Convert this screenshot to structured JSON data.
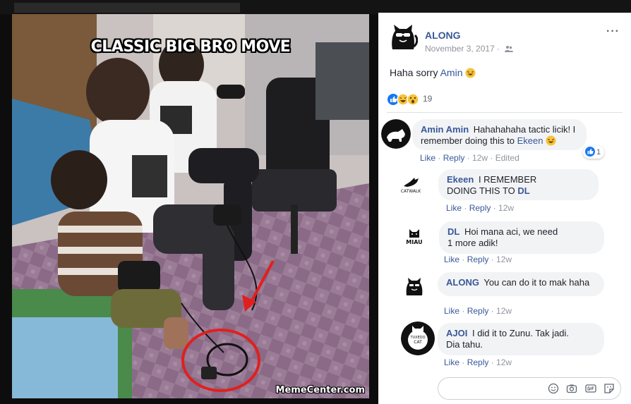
{
  "meme": {
    "caption": "CLASSIC BIG BRO MOVE",
    "watermark": "MemeCenter.com"
  },
  "post": {
    "author": "ALONG",
    "date": "November 3, 2017 ·",
    "text_prefix": "Haha sorry ",
    "mention": "Amin",
    "reaction_count": "19",
    "more_label": "···"
  },
  "comments": [
    {
      "name": "Amin Amin",
      "text_a": "Hahahahaha tactic licik! I",
      "text_b": "remember doing this to ",
      "mention": "Ekeen",
      "like": "Like",
      "reply": "Reply",
      "time": "12w",
      "edited": "Edited",
      "like_count": "1"
    },
    {
      "name": "Ekeen",
      "text_a": "I REMEMBER",
      "text_b": "DOING THIS TO ",
      "mention": "DL",
      "like": "Like",
      "reply": "Reply",
      "time": "12w",
      "avatar_text": "CATWALK"
    },
    {
      "name": "DL",
      "text_a": "Hoi mana aci, we  need",
      "text_b": "1 more adik!",
      "like": "Like",
      "reply": "Reply",
      "time": "12w",
      "avatar_text": "MIAU"
    },
    {
      "name": "ALONG",
      "text_a": "You can do it to mak haha",
      "like": "Like",
      "reply": "Reply",
      "time": "12w"
    },
    {
      "name": "AJOI",
      "text_a": "I did it to Zunu. Tak jadi.",
      "text_b": "Dia tahu.",
      "like": "Like",
      "reply": "Reply",
      "time": "12w",
      "avatar_text_a": "TUXEDO",
      "avatar_text_b": "CAT"
    }
  ],
  "input": {
    "placeholder": ""
  },
  "colors": {
    "link": "#385898",
    "bubble": "#f2f3f5",
    "meta": "#90949c",
    "like_blue": "#1877f2",
    "arrow_red": "#e0201e"
  },
  "icons": [
    "people-icon",
    "like-reaction-icon",
    "haha-reaction-icon",
    "wow-reaction-icon",
    "laughing-emoji",
    "smiley-icon",
    "camera-icon",
    "gif-icon",
    "sticker-icon",
    "more-options-icon"
  ]
}
